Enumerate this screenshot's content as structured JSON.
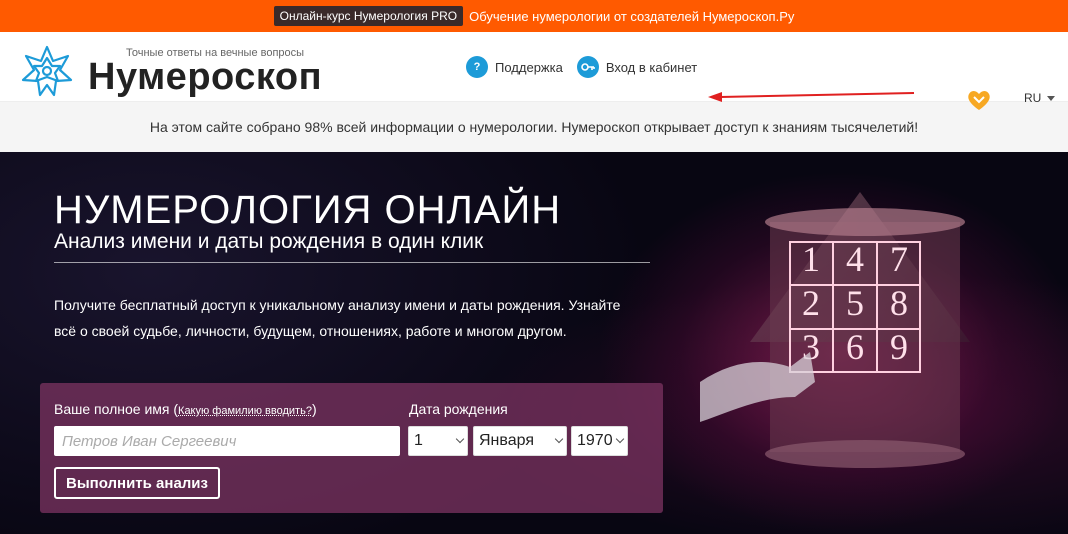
{
  "promo": {
    "badge": "Онлайн-курс Нумерология PRO",
    "link": "Обучение нумерологии от создателей Нумероскоп.Ру"
  },
  "header": {
    "tagline": "Точные ответы на вечные вопросы",
    "logo_name": "Нумероскоп",
    "nav": {
      "support": "Поддержка",
      "login": "Вход в кабинет"
    },
    "lang": "RU"
  },
  "info_bar": {
    "text": "На этом сайте собрано 98% всей информации о нумерологии. Нумероскоп открывает доступ к знаниям тысячелетий!"
  },
  "hero": {
    "title": "НУМЕРОЛОГИЯ ОНЛАЙН",
    "subtitle": "Анализ имени и даты рождения в один клик",
    "description": "Получите бесплатный доступ к уникальному анализу имени и даты рождения. Узнайте всё о своей судьбе, личности, будущем, отношениях, работе и многом другом.",
    "grid_numbers": [
      "1",
      "4",
      "7",
      "2",
      "5",
      "8",
      "3",
      "6",
      "9"
    ]
  },
  "form": {
    "name_label": "Ваше полное имя (",
    "name_hint": "Какую фамилию вводить?",
    "name_label_end": ")",
    "name_placeholder": "Петров Иван Сергеевич",
    "date_label": "Дата рождения",
    "day": "1",
    "month": "Января",
    "year": "1970",
    "submit": "Выполнить анализ"
  },
  "colors": {
    "promo_bg": "#ff5a00",
    "accent_blue": "#1d9bd8",
    "form_bg": "#784b5f"
  }
}
